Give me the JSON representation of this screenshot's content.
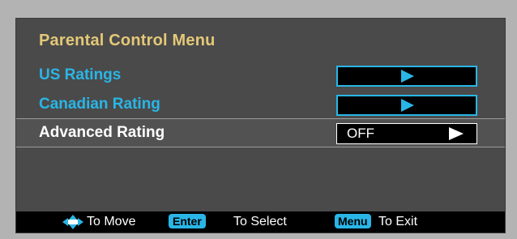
{
  "title": "Parental Control Menu",
  "items": [
    {
      "label": "US Ratings",
      "value": ""
    },
    {
      "label": "Canadian Rating",
      "value": ""
    },
    {
      "label": "Advanced Rating",
      "value": "OFF"
    }
  ],
  "help": {
    "move": "To Move",
    "enter_key": "Enter",
    "select": "To Select",
    "menu_key": "Menu",
    "exit": "To Exit"
  },
  "colors": {
    "title": "#e4c878",
    "accent": "#29b6e6",
    "panel": "#4a4a4a",
    "background": "#b3b3b3"
  },
  "icons": {
    "navigate": "four-way-arrow-icon",
    "submenu": "arrow-right-icon"
  }
}
